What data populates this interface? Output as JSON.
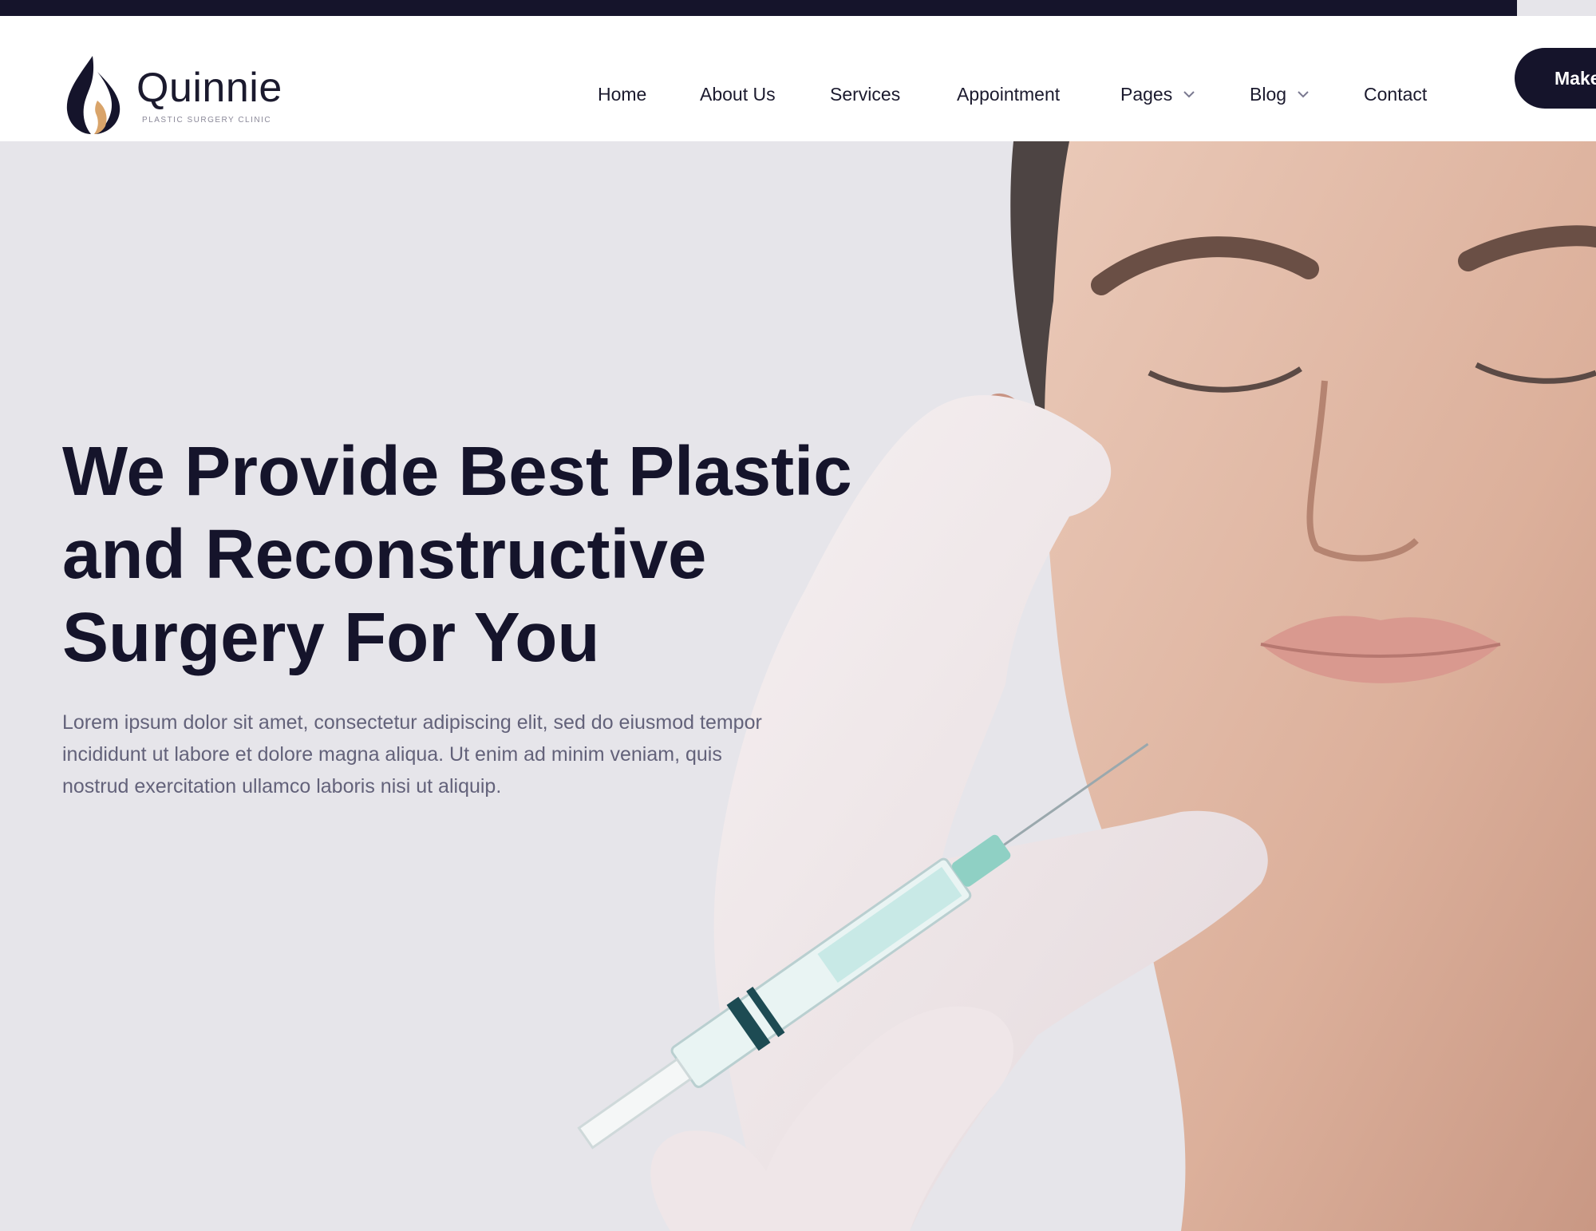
{
  "brand": {
    "name": "Quinnie",
    "tagline": "PLASTIC SURGERY CLINIC",
    "colors": {
      "dark": "#15142b",
      "accent": "#d9a46a",
      "background": "#e6e5ea"
    }
  },
  "nav": {
    "items": [
      {
        "label": "Home"
      },
      {
        "label": "About Us"
      },
      {
        "label": "Services"
      },
      {
        "label": "Appointment"
      },
      {
        "label": "Pages",
        "icon": "chevron-down-icon"
      },
      {
        "label": "Blog",
        "icon": "chevron-down-icon"
      },
      {
        "label": "Contact"
      }
    ],
    "cta_label": "Make"
  },
  "hero": {
    "headline": "We Provide Best Plastic and Reconstructive Surgery For You",
    "body": "Lorem ipsum dolor sit amet, consectetur adipiscing elit, sed do eiusmod tempor incididunt ut labore et dolore magna aliqua. Ut enim ad minim veniam, quis nostrud exercitation ullamco laboris nisi ut aliquip."
  }
}
